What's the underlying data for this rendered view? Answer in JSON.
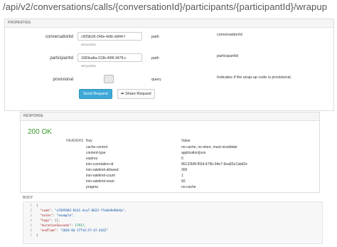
{
  "page": {
    "title": "/api/v2/conversations/calls/{conversationId}/participants/{participantId}/wrapup"
  },
  "properties": {
    "header": "PROPERTIES",
    "params": [
      {
        "name": "conversationId",
        "value": "c6f2bb36-249e-4d9c-b844-f",
        "required": "REQUIRED",
        "in": "path",
        "desc": "conversationId"
      },
      {
        "name": "participantId",
        "value": "1583ea8a-313b-40f6-9478-c",
        "required": "REQUIRED",
        "in": "path",
        "desc": "participantId"
      },
      {
        "name": "provisional",
        "in": "query",
        "desc": "Indicates if the wrap-up code is provisional."
      }
    ],
    "send_label": "Send Request",
    "share_label": "Share Request",
    "share_icon": "share-icon"
  },
  "response": {
    "header": "RESPONSE",
    "status": "200 OK",
    "headers_label": "HEADERS",
    "key_col": "Key",
    "value_col": "Value",
    "headers": [
      {
        "key": "cache-control",
        "value": "no-cache, no-store, must-revalidate"
      },
      {
        "key": "content-type",
        "value": "application/json"
      },
      {
        "key": "expires",
        "value": "0"
      },
      {
        "key": "inin-correlation-id",
        "value": "86132bf8-f554-476b-94e7-9ea82a7abd2e"
      },
      {
        "key": "inin-ratelimit-allowed",
        "value": "300"
      },
      {
        "key": "inin-ratelimit-count",
        "value": "1"
      },
      {
        "key": "inin-ratelimit-reset",
        "value": "60"
      },
      {
        "key": "pragma",
        "value": "no-cache"
      }
    ],
    "body_label": "BODY",
    "body_lines": [
      {
        "n": "1",
        "text": "{"
      },
      {
        "n": "2",
        "key": "\"code\"",
        "val": "\"a7695982-8141-4ca7-8622-f7e0e9b98e6a\","
      },
      {
        "n": "3",
        "key": "\"notes\"",
        "val": "\"example\","
      },
      {
        "n": "4",
        "key": "\"tags\"",
        "val": "[],"
      },
      {
        "n": "5",
        "key": "\"durationSeconds\"",
        "val": "17917,"
      },
      {
        "n": "6",
        "key": "\"endTime\"",
        "val": "\"2018-04-17T14:57:47.443Z\""
      },
      {
        "n": "7",
        "text": "}"
      }
    ]
  }
}
